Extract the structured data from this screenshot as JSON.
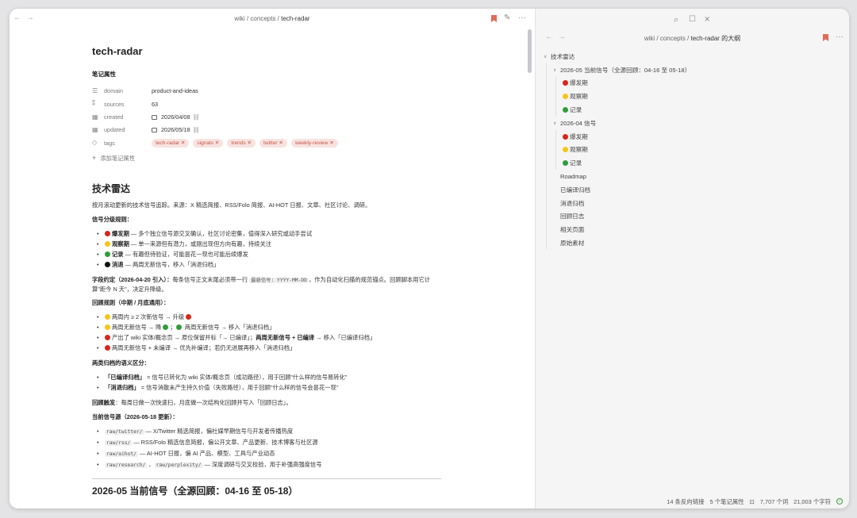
{
  "left_header": {
    "breadcrumb_prefix": "wiki / concepts / ",
    "breadcrumb_current": "tech-radar"
  },
  "note": {
    "title": "tech-radar",
    "props_label": "笔记属性",
    "properties": {
      "domain": {
        "key": "domain",
        "value": "product-and-ideas"
      },
      "sources": {
        "key": "sources",
        "value": "63"
      },
      "created": {
        "key": "created",
        "value": "2026/04/08"
      },
      "updated": {
        "key": "updated",
        "value": "2026/05/18"
      },
      "tags": {
        "key": "tags",
        "values": [
          "tech-radar ✕",
          "signals ✕",
          "trends ✕",
          "twitter ✕",
          "weekly-review ✕"
        ]
      }
    },
    "add_property": "添加笔记属性"
  },
  "body": {
    "h_tech_radar": "技术雷达",
    "intro": "按月滚动更新的技术信号追踪。来源：X 精选简报、RSS/Folo 简报、AI-HOT 日报、文章、社区讨论、调研。",
    "levels_label": "信号分级规则：",
    "levels": [
      {
        "name": "爆发期",
        "desc": " — 多个独立信号源交叉确认，社区讨论密集，值得深入研究或动手尝试"
      },
      {
        "name": "观察期",
        "desc": " — 单一来源但有潜力，或刚出现但方向有趣，持续关注"
      },
      {
        "name": "记录",
        "desc": " — 有趣但待验证，可能昙花一现也可能后续爆发"
      },
      {
        "name": "消退",
        "desc": " — 两周无新信号，移入「消退归档」"
      }
    ],
    "field_label": "字段约定（2026-04-20 引入）：",
    "field_text_1": "每条信号正文末尾必须带一行 ",
    "field_code": "最新信号: YYYY-MM-DD",
    "field_text_2": "，作为自动化扫描的规范锚点。回顾脚本用它计算\"距今 N 天\"，决定升降级。",
    "review_label": "回顾规则（中期 / 月底通用）：",
    "review_rules": {
      "r1_a": "两周内 ≥ 2 次新信号 → 升级 ",
      "r2_a": "两周无新信号 → 降 ",
      "r2_b": "；",
      "r2_c": " 两周无新信号 → 移入「消退归档」",
      "r3_a": "产出了 wiki 实体/概念页 → 原位保留并标「→ 已编译」；",
      "r3_b": "两周无新信号 + 已编译",
      "r3_c": " → 移入「已编译归档」",
      "r4_a": "两周无新信号 + 未编译 → 优先补编译；若仍无进展再移入「消退归档」"
    },
    "archive_label": "两类归档的语义区分：",
    "archives": [
      {
        "name": "「已编译归档」",
        "desc": " = 信号已转化为 wiki 实体/概念页（成功路径），用于回顾\"什么样的信号易转化\""
      },
      {
        "name": "「消退归档」",
        "desc": " = 信号消散未产生持久价值（失败路径），用于回顾\"什么样的信号会昙花一现\""
      }
    ],
    "trigger_label": "回顾触发",
    "trigger_text": "：每周日做一次快速扫，月底做一次结构化回顾并写入「回顾日志」。",
    "sources_label": "当前信号源（2026-05-18 更新）：",
    "sources": [
      {
        "code": "raw/twitter/",
        "desc": " — X/Twitter 精选简报，偏社媒早期信号与开发者传播热度"
      },
      {
        "code": "raw/rss/",
        "desc": " — RSS/Folo 精选信息简报，偏公开文章、产品更新、技术博客与社区源"
      },
      {
        "code": "raw/aihot/",
        "desc": " — AI-HOT 日报，偏 AI 产品、模型、工具与产业动态"
      }
    ],
    "src_last_code1": "raw/research/",
    "src_last_mid": " 、",
    "src_last_code2": "raw/perplexity/",
    "src_last_desc": " — 深度调研与交叉校验，用于补强高强度信号",
    "h_cut": "2026-05 当前信号（全源回顾：04-16 至 05-18）"
  },
  "right_header": {
    "breadcrumb_prefix": "wiki / concepts / ",
    "breadcrumb_current": "tech-radar 的大纲"
  },
  "outline": {
    "root": "技术雷达",
    "g1": "2026-05 当前信号（全源回顾：04-16 至 05-18）",
    "g1_items": [
      "爆发期",
      "观察期",
      "记录"
    ],
    "g2": "2026-04 信号",
    "g2_items": [
      "爆发期",
      "观察期",
      "记录"
    ],
    "others": [
      "Roadmap",
      "已编译归档",
      "消退归档",
      "回顾日志",
      "相关页面",
      "原始素材"
    ]
  },
  "statusbar": {
    "backlinks": "14 条反向链接",
    "props": "5 个笔记属性",
    "words": "7,707 个词",
    "chars": "21,003 个字符"
  },
  "colors": {
    "red": "#d9261c",
    "yellow": "#f5c518",
    "green": "#2f9e3a",
    "tag_bg": "#f8e3df",
    "tag_fg": "#c4554a",
    "bookmark": "#e26a5a"
  }
}
